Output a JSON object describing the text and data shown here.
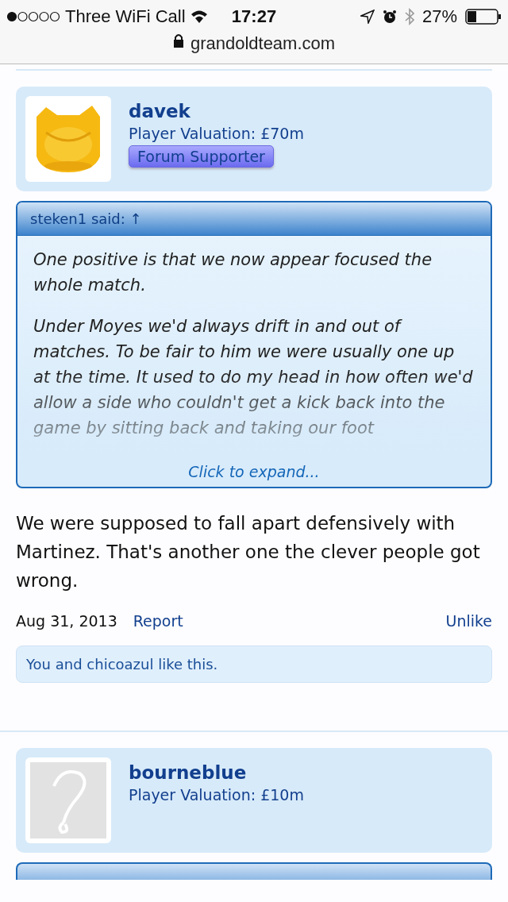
{
  "status_bar": {
    "carrier": "Three WiFi Call",
    "time": "17:27",
    "battery": "27%"
  },
  "url_bar": {
    "address": "grandoldteam.com"
  },
  "posts": [
    {
      "username": "davek",
      "valuation": "Player Valuation: £70m",
      "badge": "Forum Supporter",
      "quote": {
        "author": "steken1 said: ↑",
        "paragraphs": [
          "One positive is that we now appear focused the whole match.",
          "Under Moyes we'd always drift in and out of matches. To be fair to him we were usually one up at the time. It used to do my head in how often we'd allow a side who couldn't get a kick back into the game by sitting back and taking our foot"
        ],
        "expand": "Click to expand..."
      },
      "message": "We were supposed to fall apart defensively with Martinez. That's another one the clever people got wrong.",
      "date": "Aug 31, 2013",
      "report": "Report",
      "like_action": "Unlike",
      "likes": "You and chicoazul like this."
    },
    {
      "username": "bourneblue",
      "valuation": "Player Valuation: £10m",
      "avatar": {
        "kind": "placeholder"
      }
    }
  ]
}
